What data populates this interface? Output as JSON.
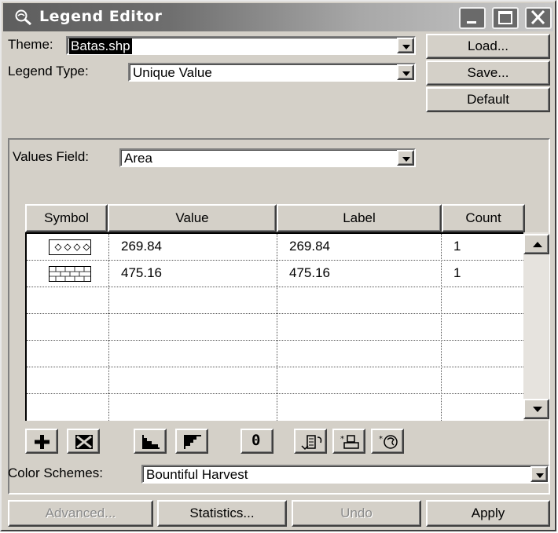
{
  "window": {
    "title": "Legend Editor"
  },
  "top": {
    "theme_label": "Theme:",
    "theme_value": "Batas.shp",
    "legend_type_label": "Legend Type:",
    "legend_type_value": "Unique Value",
    "load_label": "Load...",
    "save_label": "Save...",
    "default_label": "Default"
  },
  "values": {
    "field_label": "Values Field:",
    "field_value": "Area"
  },
  "table": {
    "headers": [
      "Symbol",
      "Value",
      "Label",
      "Count"
    ],
    "rows": [
      {
        "symbol": "dotted-pattern-icon",
        "value": "269.84",
        "label": "269.84",
        "count": "1"
      },
      {
        "symbol": "brick-pattern-icon",
        "value": "475.16",
        "label": "475.16",
        "count": "1"
      }
    ],
    "empty_rows": 5
  },
  "toolbar": {
    "icons": [
      "add-icon",
      "delete-icon",
      "sort-ascending-icon",
      "sort-descending-icon",
      "null-value-icon",
      "reverse-icon",
      "copy-symbol-icon",
      "paste-symbol-icon"
    ],
    "null_label": "0"
  },
  "colors": {
    "label": "Color Schemes:",
    "value": "Bountiful Harvest"
  },
  "bottom": {
    "advanced_label": "Advanced...",
    "statistics_label": "Statistics...",
    "undo_label": "Undo",
    "apply_label": "Apply"
  },
  "style": {
    "face": "#d4d0c8",
    "titlebar_start": "#5e5e5e",
    "titlebar_end": "#c8c8c8"
  }
}
